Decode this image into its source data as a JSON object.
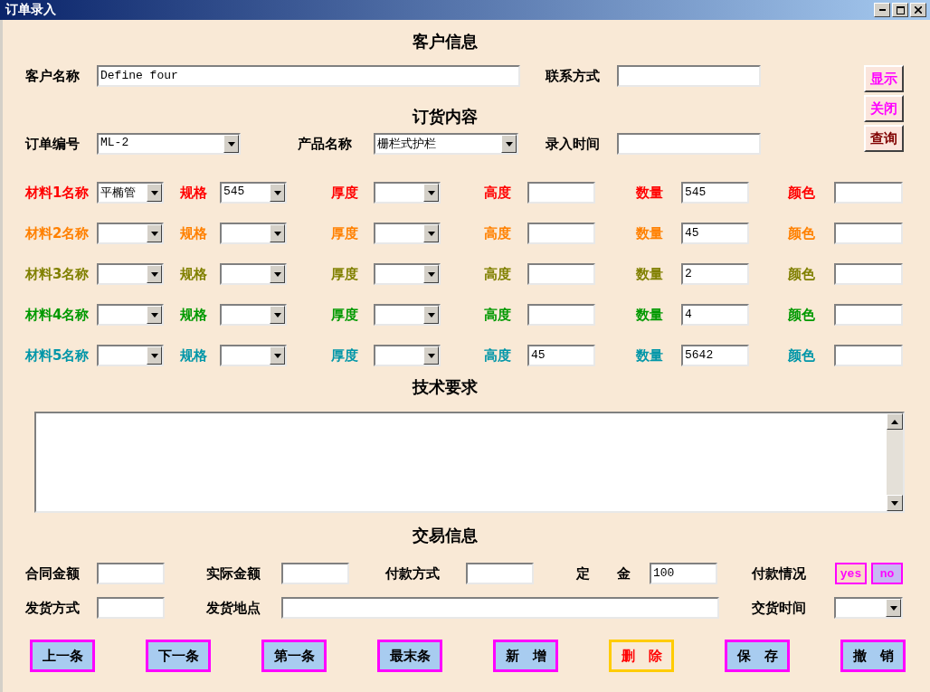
{
  "window": {
    "title": "订单录入"
  },
  "side_buttons": [
    {
      "label": "显示",
      "color": "#ff00ff"
    },
    {
      "label": "关闭",
      "color": "#ff00ff"
    },
    {
      "label": "查询",
      "color": "#800000"
    }
  ],
  "customer": {
    "heading": "客户信息",
    "name_label": "客户名称",
    "name_value": "Define four",
    "contact_label": "联系方式"
  },
  "order": {
    "heading": "订货内容",
    "number_label": "订单编号",
    "number_value": "ML-2",
    "product_label": "产品名称",
    "product_value": "栅栏式护栏",
    "time_label": "录入时间"
  },
  "materials": [
    {
      "color": "#ff0000",
      "fields": [
        {
          "label": "材料1名称",
          "kind": "combo",
          "value": "平椭管"
        },
        {
          "label": "规格",
          "kind": "combo",
          "value": "545"
        },
        {
          "label": "厚度",
          "kind": "combo"
        },
        {
          "label": "高度",
          "kind": "input"
        },
        {
          "label": "数量",
          "kind": "input",
          "value": "545"
        },
        {
          "label": "颜色",
          "kind": "input"
        }
      ]
    },
    {
      "color": "#ff8000",
      "fields": [
        {
          "label": "材料2名称",
          "kind": "combo"
        },
        {
          "label": "规格",
          "kind": "combo"
        },
        {
          "label": "厚度",
          "kind": "combo"
        },
        {
          "label": "高度",
          "kind": "input"
        },
        {
          "label": "数量",
          "kind": "input",
          "value": "45"
        },
        {
          "label": "颜色",
          "kind": "input"
        }
      ]
    },
    {
      "color": "#808000",
      "fields": [
        {
          "label": "材料3名称",
          "kind": "combo"
        },
        {
          "label": "规格",
          "kind": "combo"
        },
        {
          "label": "厚度",
          "kind": "combo"
        },
        {
          "label": "高度",
          "kind": "input"
        },
        {
          "label": "数量",
          "kind": "input",
          "value": "2"
        },
        {
          "label": "颜色",
          "kind": "input"
        }
      ]
    },
    {
      "color": "#009900",
      "fields": [
        {
          "label": "材料4名称",
          "kind": "combo"
        },
        {
          "label": "规格",
          "kind": "combo"
        },
        {
          "label": "厚度",
          "kind": "combo"
        },
        {
          "label": "高度",
          "kind": "input"
        },
        {
          "label": "数量",
          "kind": "input",
          "value": "4"
        },
        {
          "label": "颜色",
          "kind": "input"
        }
      ]
    },
    {
      "color": "#0096a8",
      "fields": [
        {
          "label": "材料5名称",
          "kind": "combo"
        },
        {
          "label": "规格",
          "kind": "combo"
        },
        {
          "label": "厚度",
          "kind": "combo"
        },
        {
          "label": "高度",
          "kind": "input",
          "value": "45"
        },
        {
          "label": "数量",
          "kind": "input",
          "value": "5642"
        },
        {
          "label": "颜色",
          "kind": "input"
        }
      ]
    }
  ],
  "tech": {
    "heading": "技术要求"
  },
  "trade": {
    "heading": "交易信息",
    "payment_row": [
      {
        "label": "合同金额",
        "kind": "input"
      },
      {
        "label": "实际金额",
        "kind": "input"
      },
      {
        "label": "付款方式",
        "kind": "input"
      },
      {
        "label": "定　　金",
        "kind": "input",
        "value": "100"
      },
      {
        "label": "付款情况",
        "kind": "choice",
        "options": [
          {
            "label": "yes",
            "color": "#fadcc8"
          },
          {
            "label": "no",
            "color": "#c8b8f4"
          }
        ]
      }
    ],
    "shipping_row": [
      {
        "label": "发货方式",
        "kind": "input"
      },
      {
        "label": "发货地点",
        "kind": "input"
      },
      {
        "label": "交货时间",
        "kind": "combo"
      }
    ]
  },
  "nav_buttons": [
    {
      "label": "上一条",
      "kind": "normal"
    },
    {
      "label": "下一条",
      "kind": "normal"
    },
    {
      "label": "第一条",
      "kind": "normal"
    },
    {
      "label": "最末条",
      "kind": "normal"
    },
    {
      "label": "新　增",
      "kind": "normal"
    },
    {
      "label": "删　除",
      "kind": "danger"
    },
    {
      "label": "保　存",
      "kind": "normal"
    },
    {
      "label": "撤　销",
      "kind": "normal"
    }
  ]
}
